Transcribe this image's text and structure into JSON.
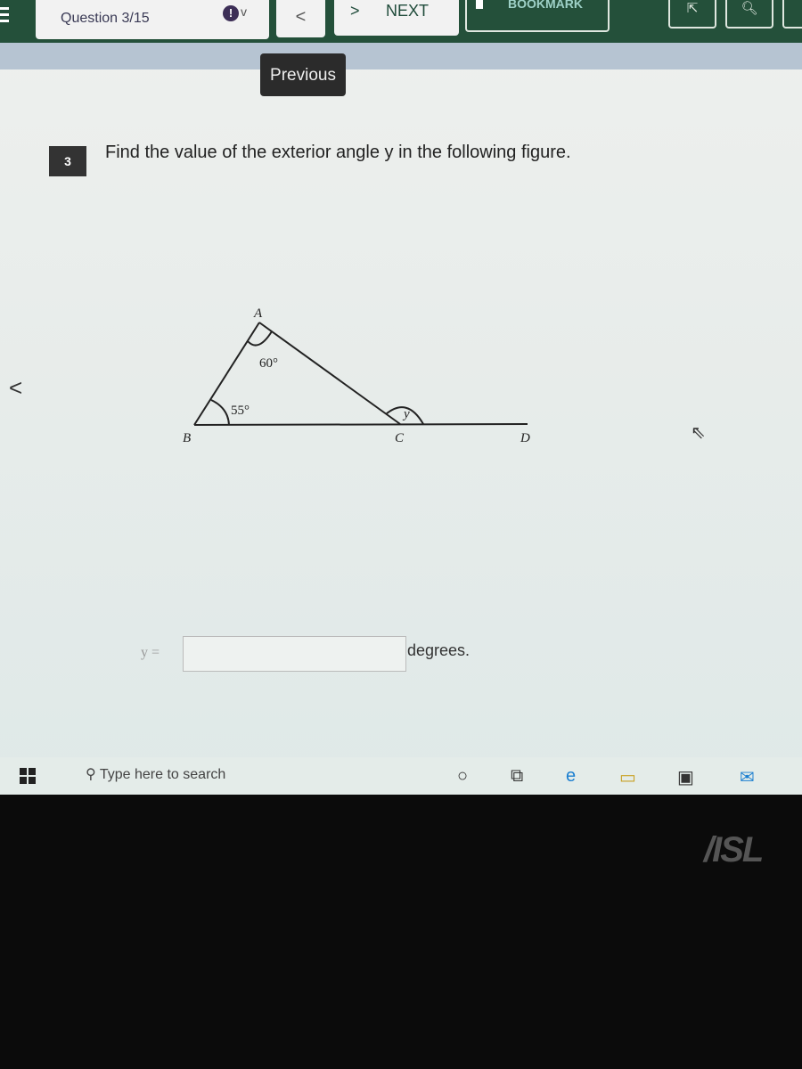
{
  "toolbar": {
    "question_counter": "Question 3/15",
    "flag_icon": "!",
    "prev_icon": "<",
    "next_icon": ">",
    "next_label": "NEXT",
    "bookmark_label": "BOOKMARK",
    "tooltip": "Previous"
  },
  "question": {
    "number": "3",
    "text": "Find the value of the exterior angle  y in the following figure.",
    "figure": {
      "vertex_a": "A",
      "vertex_b": "B",
      "vertex_c": "C",
      "point_d": "D",
      "angle_a": "60°",
      "angle_b": "55°",
      "angle_y": "y"
    },
    "answer_label": "y =",
    "answer_value": "",
    "unit": "degrees."
  },
  "taskbar": {
    "search_placeholder": "Type here to search"
  },
  "bezel": {
    "logo": "ASUS"
  },
  "colors": {
    "topbar": "#24503a",
    "accent": "#9ed1c7"
  }
}
